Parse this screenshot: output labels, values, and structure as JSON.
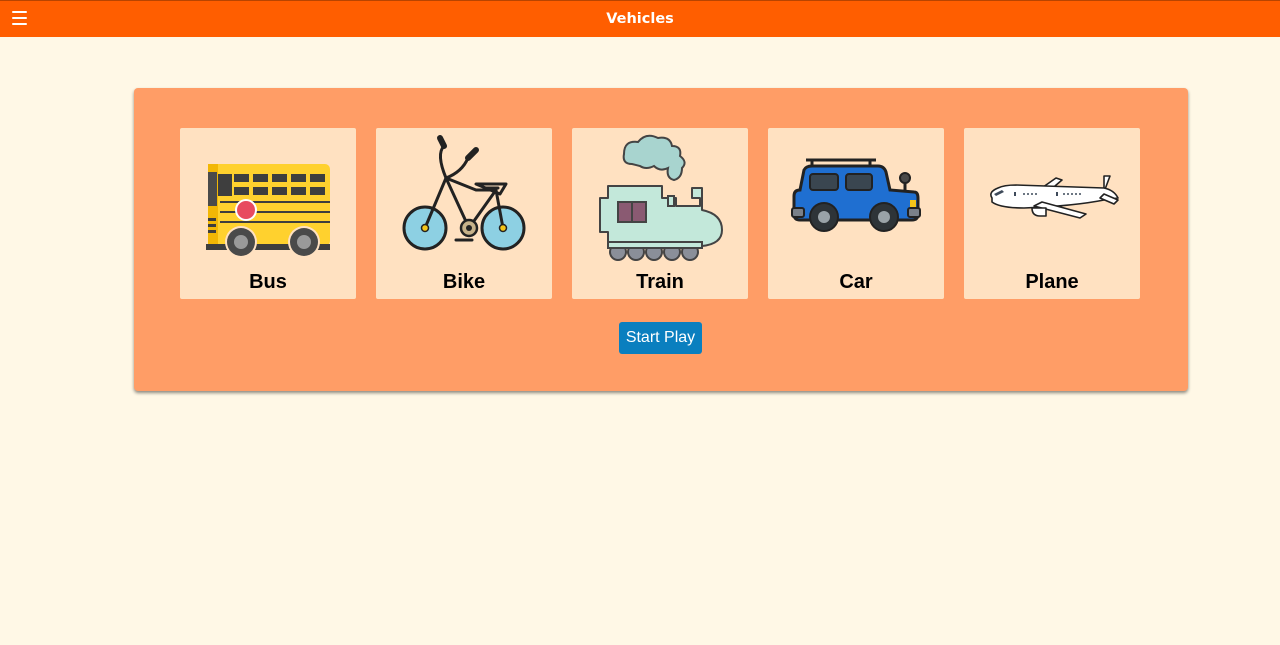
{
  "header": {
    "title": "Vehicles",
    "menu_icon": "hamburger-menu-icon"
  },
  "cards": [
    {
      "label": "Bus",
      "icon": "bus-icon"
    },
    {
      "label": "Bike",
      "icon": "bike-icon"
    },
    {
      "label": "Train",
      "icon": "train-icon"
    },
    {
      "label": "Car",
      "icon": "car-icon"
    },
    {
      "label": "Plane",
      "icon": "plane-icon"
    }
  ],
  "start_button": {
    "label": "Start Play"
  },
  "colors": {
    "header": "#ff5e00",
    "panel": "#ff9d66",
    "card": "#ffe1c1",
    "background": "#fff8e6",
    "button": "#0a7fbf"
  }
}
